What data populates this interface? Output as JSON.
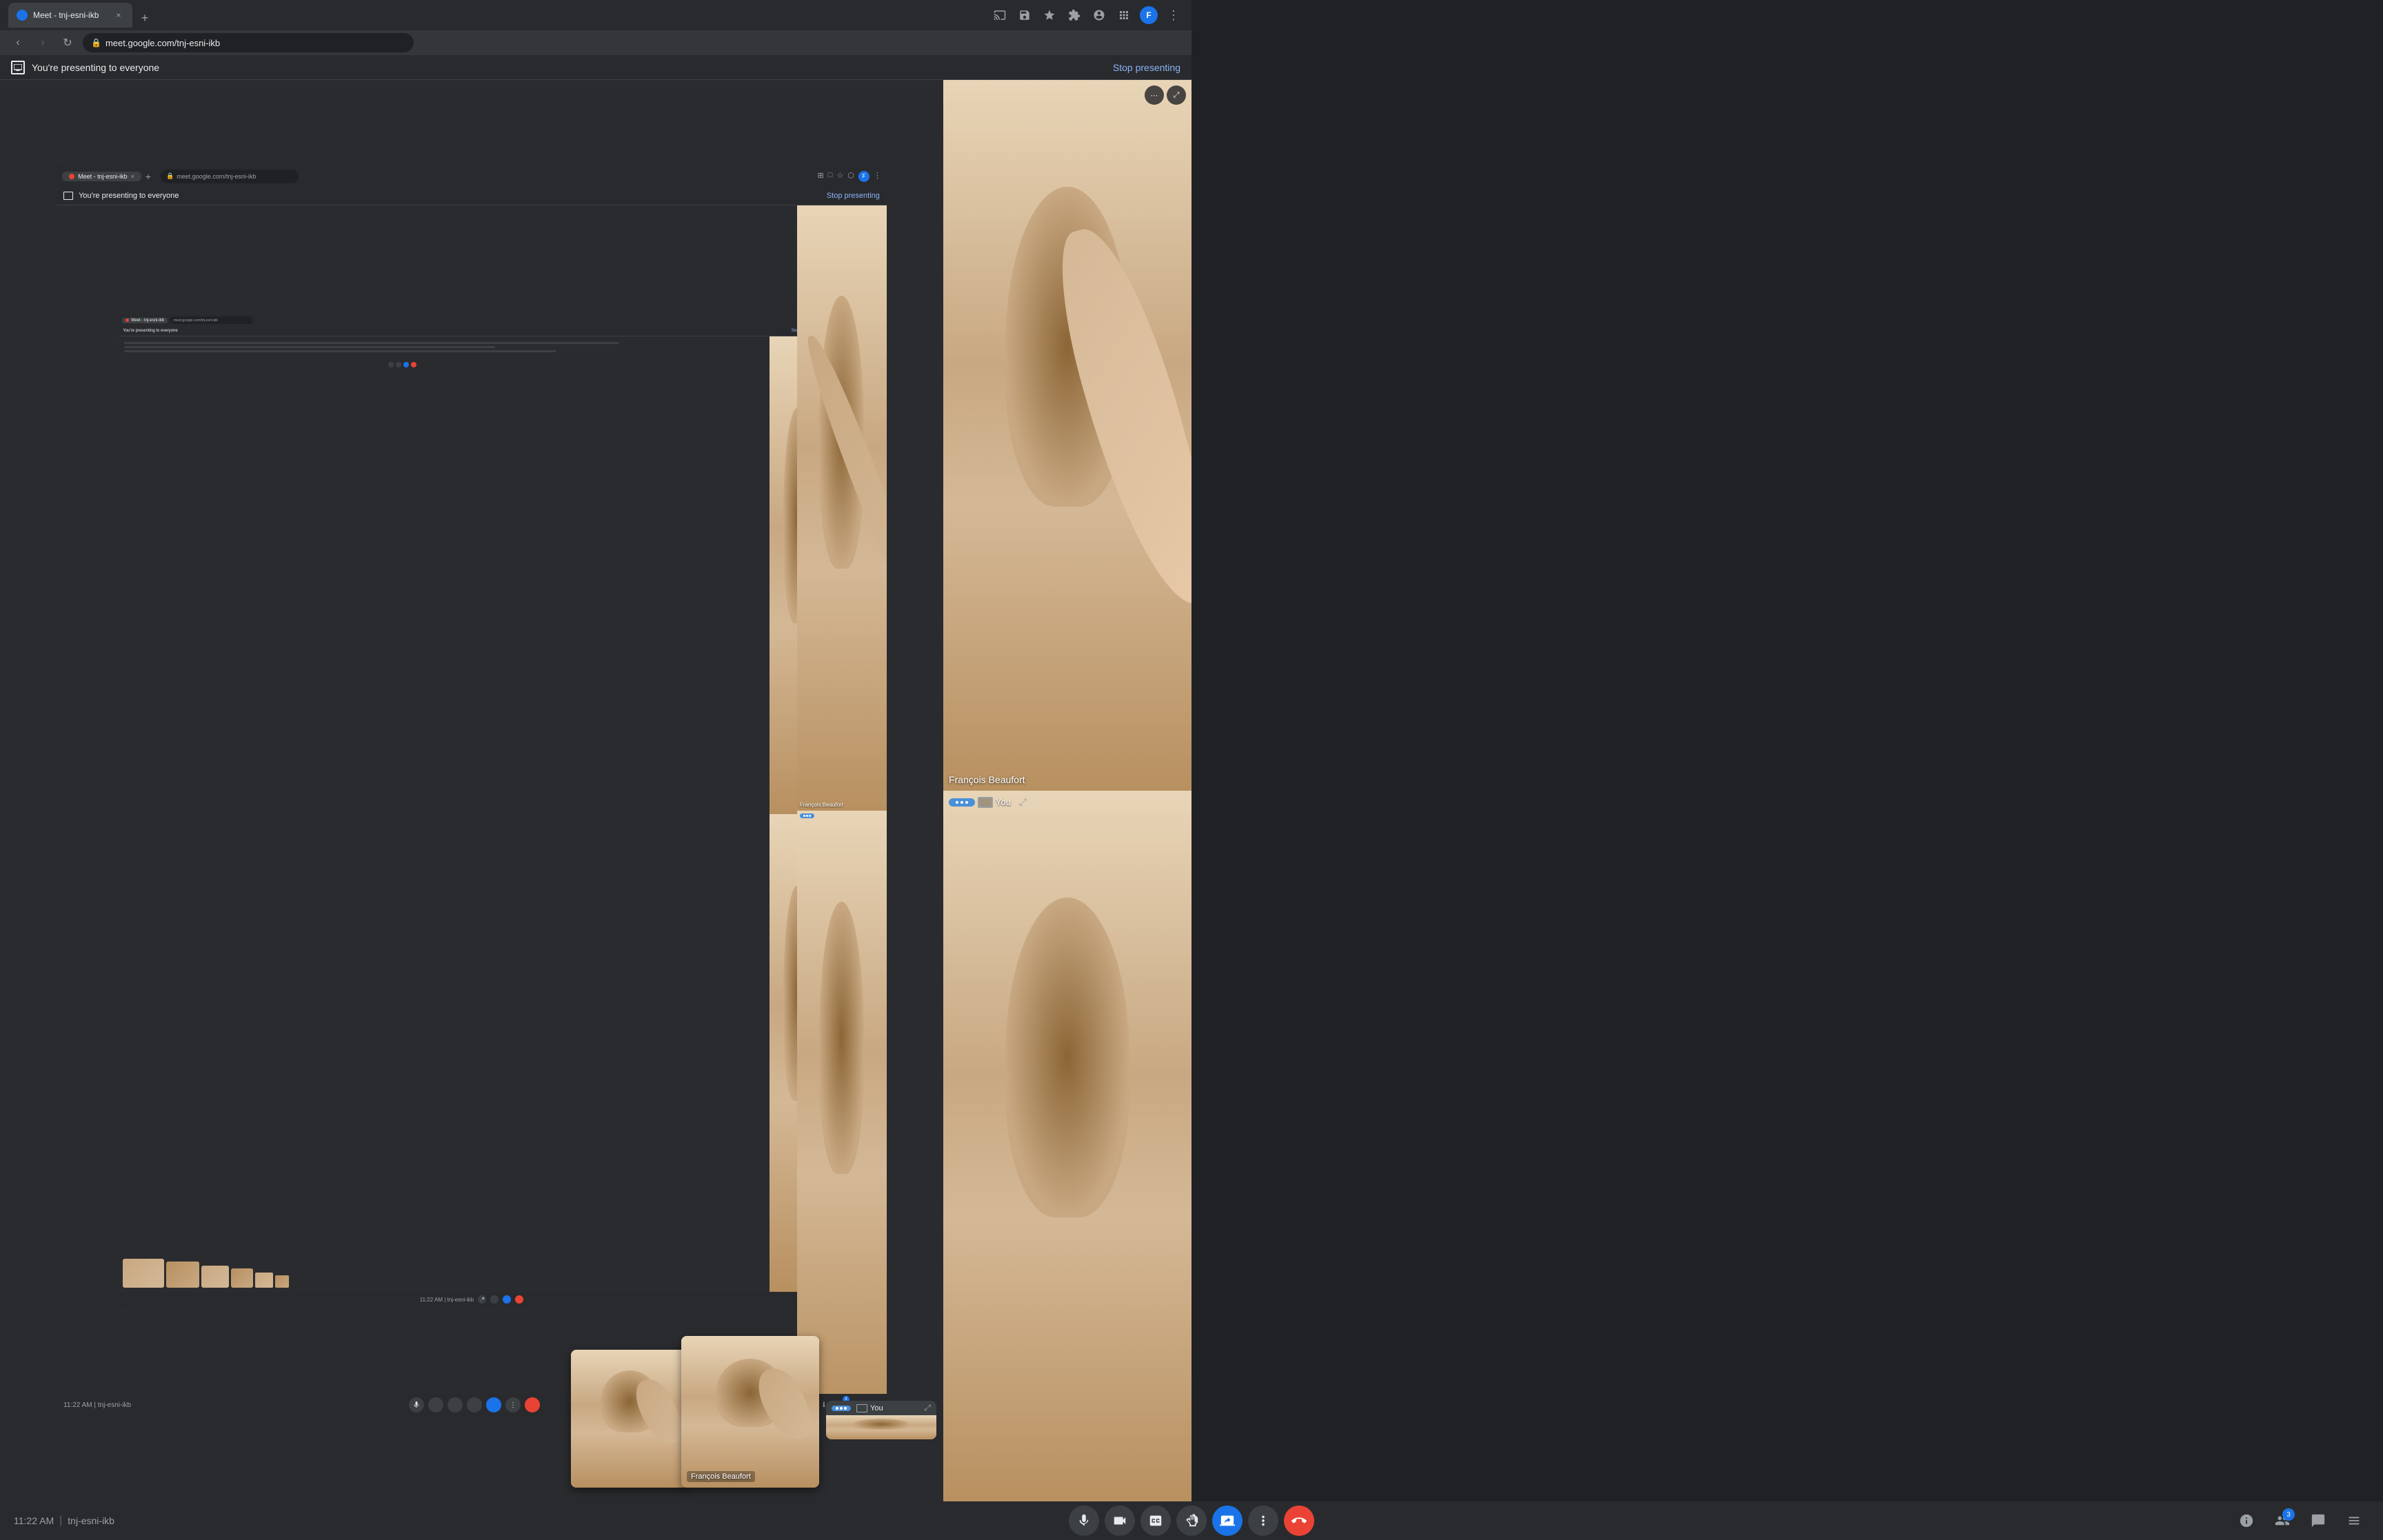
{
  "browser": {
    "tab": {
      "title": "Meet - tnj-esni-ikb",
      "favicon_color": "#ea4335",
      "close_label": "×",
      "new_tab_label": "+"
    },
    "address": "meet.google.com/tnj-esni-ikb",
    "scroll_indicator": "▼"
  },
  "presenting_banner": {
    "icon_label": "▣",
    "message": "You're presenting to everyone",
    "stop_button": "Stop presenting"
  },
  "participants": [
    {
      "name": "François Beaufort",
      "label": "François Beaufort"
    },
    {
      "name": "You",
      "label": "You"
    }
  ],
  "toolbar": {
    "time": "11:22 AM",
    "separator": "|",
    "meeting_id": "tnj-esni-ikb",
    "buttons": {
      "mic": "🎤",
      "camera": "📹",
      "captions": "CC",
      "raise_hand": "✋",
      "present": "📺",
      "more": "⋮",
      "end": "📞"
    },
    "right_buttons": {
      "info": "ℹ",
      "people": "👥",
      "chat": "💬",
      "activities": "☰"
    },
    "participant_count": "3"
  },
  "recursive_banner": {
    "message": "You're presenting to everyone",
    "stop_button": "Stop presenting"
  },
  "recursive2": {
    "banner_message": "You're presenting to everyone",
    "stop_button": "Stop presenting"
  }
}
